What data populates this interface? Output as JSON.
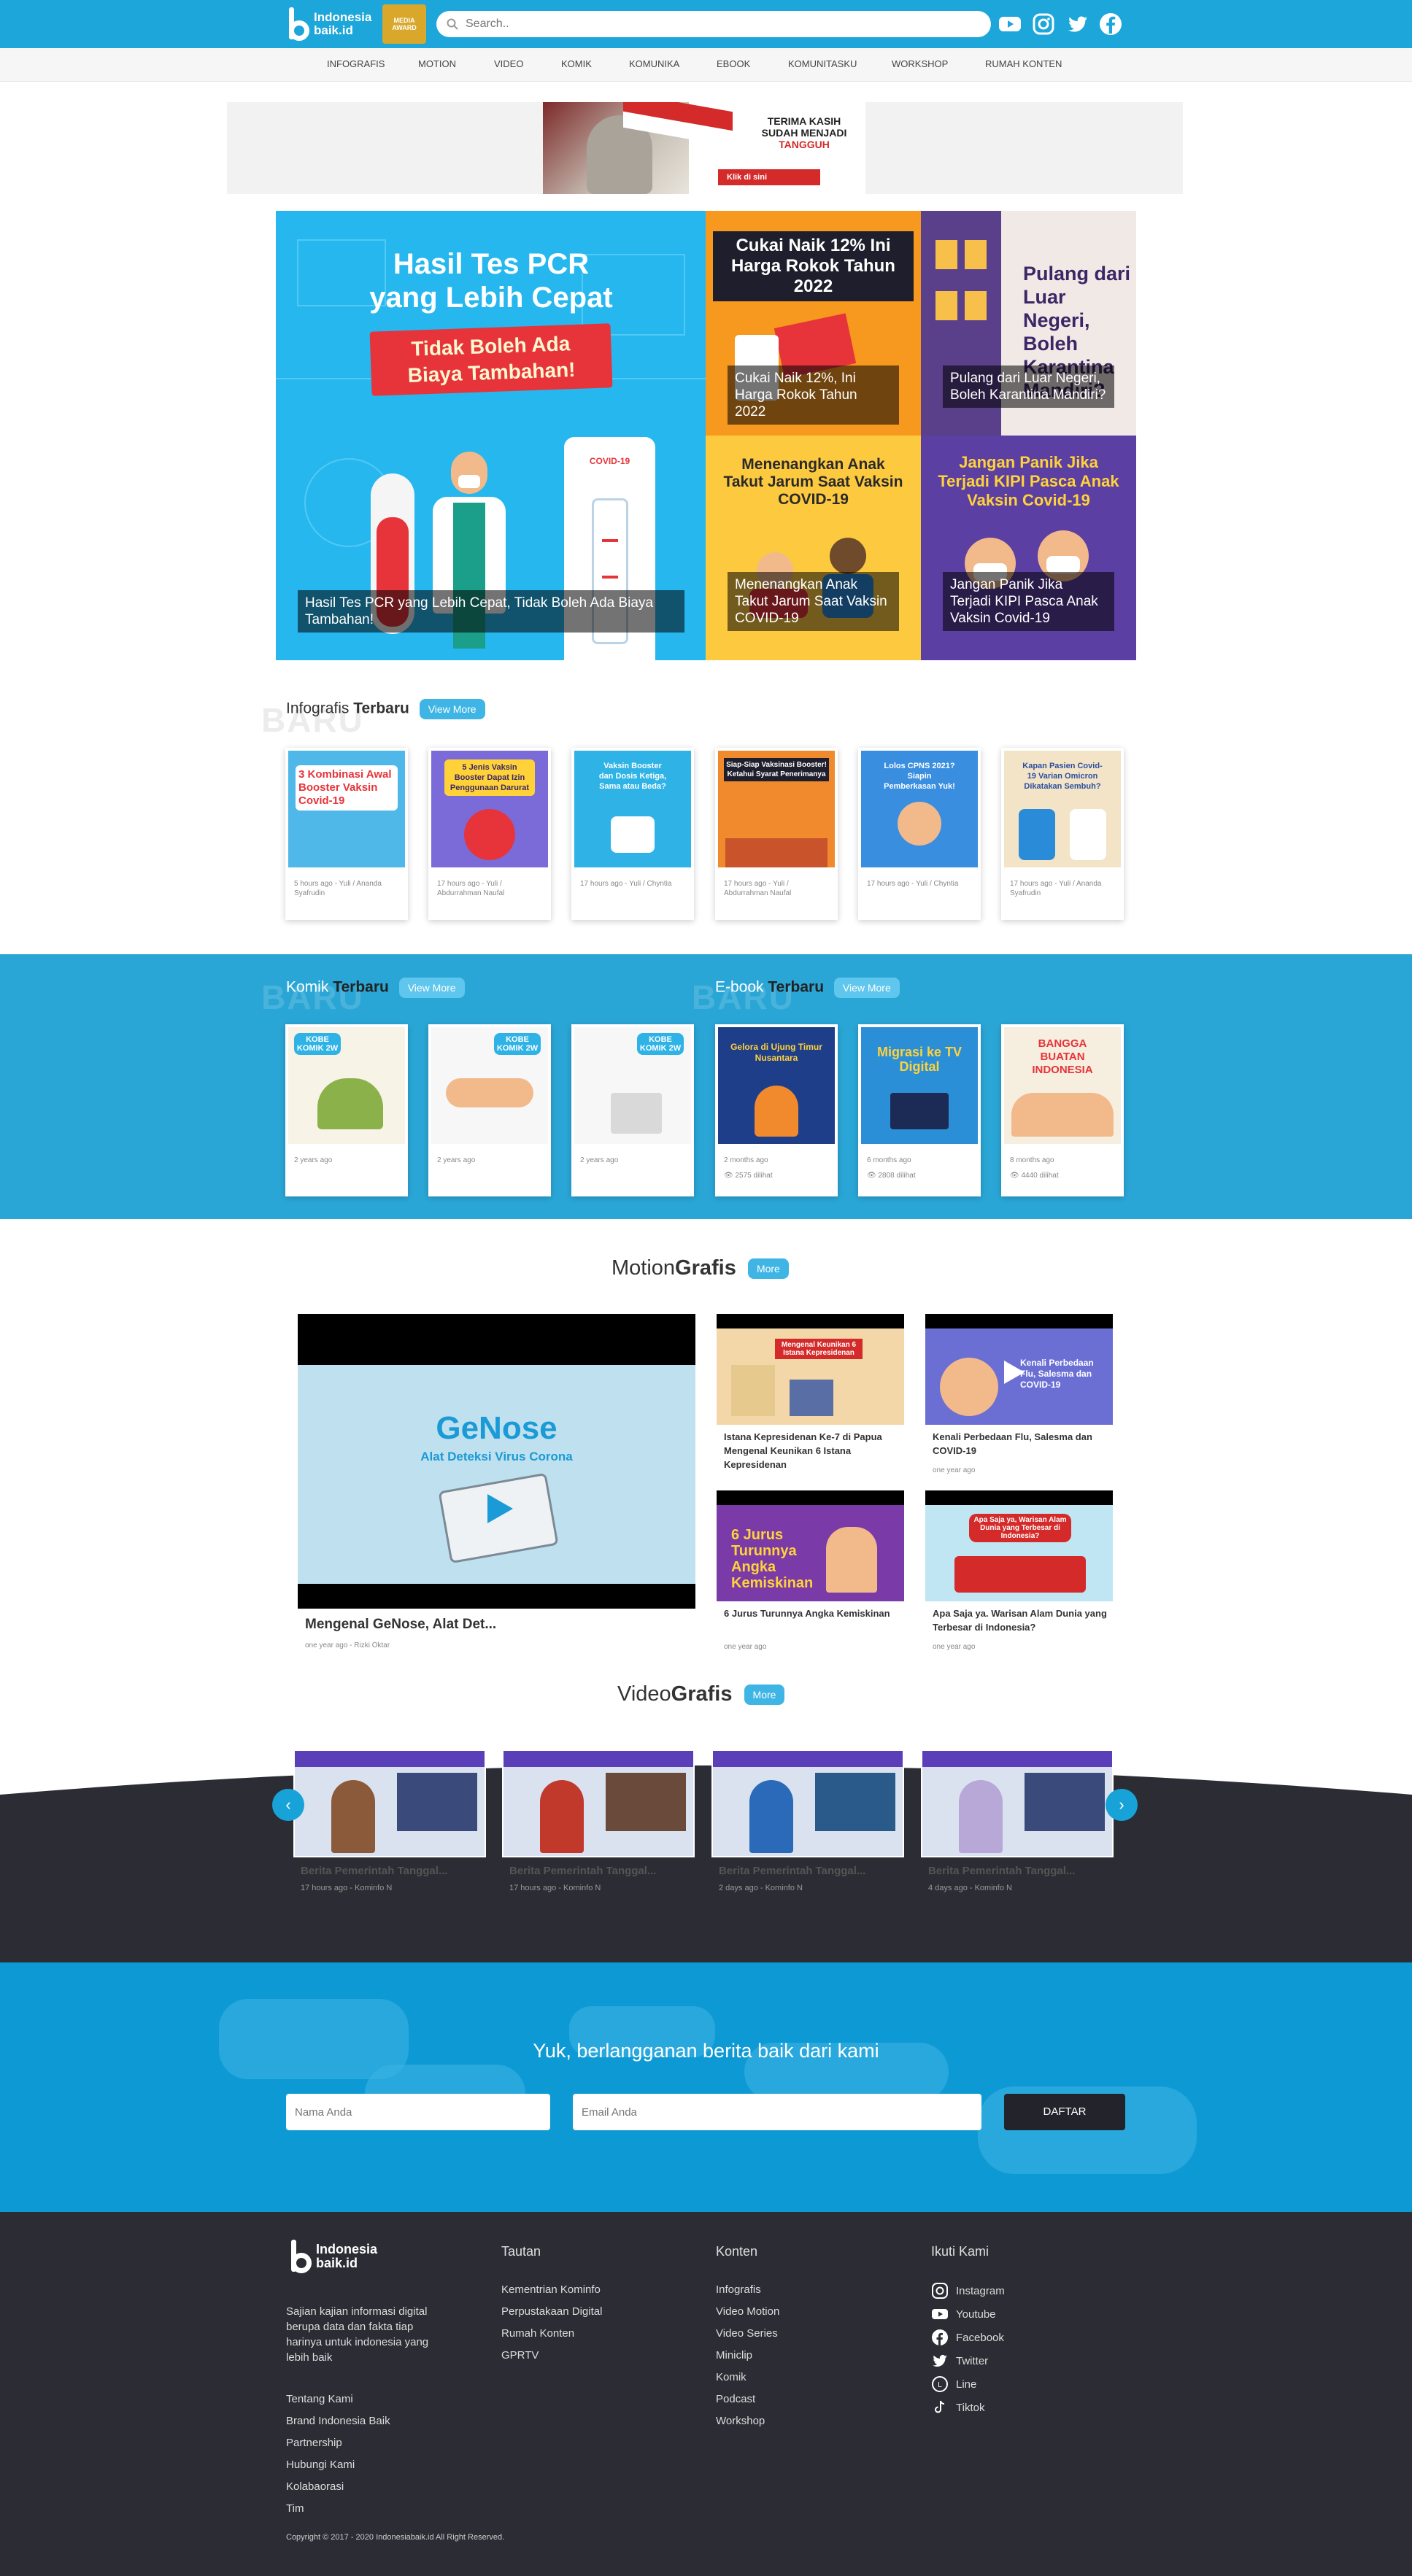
{
  "header": {
    "logo_line1": "Indonesia",
    "logo_line2": "baik.id",
    "emblem_text": "MEDIA AWARD",
    "search_placeholder": "Search..",
    "social_icons": [
      "youtube-icon",
      "instagram-icon",
      "twitter-icon",
      "facebook-icon"
    ]
  },
  "nav": {
    "items": [
      "INFOGRAFIS",
      "MOTION",
      "VIDEO",
      "KOMIK",
      "KOMUNIKA",
      "EBOOK",
      "KOMUNITASKU",
      "WORKSHOP",
      "RUMAH KONTEN"
    ]
  },
  "banner": {
    "line1": "TERIMA KASIH",
    "line2": "SUDAH MENJADI",
    "line3": "TANGGUH",
    "cta": "Klik di sini"
  },
  "hero": {
    "main": {
      "art_title1": "Hasil Tes PCR",
      "art_title2": "yang Lebih Cepat",
      "art_sub1": "Tidak Boleh Ada",
      "art_sub2": "Biaya Tambahan!",
      "caption": "Hasil Tes PCR yang Lebih Cepat, Tidak Boleh Ada Biaya Tambahan!",
      "tube_label": "COVID-19"
    },
    "tiles": [
      {
        "art": "Cukai Naik 12% Ini Harga Rokok Tahun 2022",
        "caption": "Cukai Naik 12%, Ini Harga Rokok Tahun 2022"
      },
      {
        "art": "Pulang dari Luar Negeri, Boleh Karantina Mandiri?",
        "caption": "Pulang dari Luar Negeri, Boleh Karantina Mandiri?"
      },
      {
        "art": "Menenangkan Anak Takut Jarum Saat Vaksin COVID-19",
        "caption": "Menenangkan Anak Takut Jarum Saat Vaksin COVID-19"
      },
      {
        "art": "Jangan Panik Jika Terjadi KIPI Pasca Anak Vaksin Covid-19",
        "caption": "Jangan Panik Jika Terjadi KIPI Pasca Anak Vaksin Covid-19"
      }
    ]
  },
  "infografis": {
    "label_light": "Infografis",
    "label_bold": "Terbaru",
    "ghost": "BARU",
    "view_more": "View More",
    "cards": [
      {
        "art": "3 Kombinasi Awal Booster Vaksin Covid-19",
        "meta": "5 hours ago - Yuli / Ananda Syafrudin",
        "color": "#4fb8e8"
      },
      {
        "art": "5 Jenis Vaksin Booster Dapat Izin Penggunaan Darurat",
        "meta": "17 hours ago - Yuli / Abdurrahman Naufal",
        "color": "#7b6bd9"
      },
      {
        "art": "Vaksin Booster dan Dosis Ketiga, Sama atau Beda?",
        "meta": "17 hours ago - Yuli / Chyntia",
        "color": "#2fb3e6"
      },
      {
        "art": "Siap-Siap Vaksinasi Booster! Ketahui Syarat Penerimanya",
        "meta": "17 hours ago - Yuli / Abdurrahman Naufal",
        "color": "#f08a2c"
      },
      {
        "art": "Lolos CPNS 2021? Siapin Pemberkasan Yuk!",
        "meta": "17 hours ago - Yuli / Chyntia",
        "color": "#3a8ee0"
      },
      {
        "art": "Kapan Pasien Covid-19 Varian Omicron Dikatakan Sembuh?",
        "meta": "17 hours ago - Yuli / Ananda Syafrudin",
        "color": "#f3e3c7"
      }
    ]
  },
  "komik": {
    "label_light": "Komik",
    "label_bold": "Terbaru",
    "ghost": "BARU",
    "view_more": "View More",
    "cards": [
      {
        "art": "KOBE KOMIK 2W",
        "meta": "2 years ago"
      },
      {
        "art": "KOBE KOMIK 2W",
        "meta": "2 years ago"
      },
      {
        "art": "KOBE KOMIK 2W",
        "meta": "2 years ago"
      }
    ]
  },
  "ebook": {
    "label_light": "E-book",
    "label_bold": "Terbaru",
    "ghost": "BARU",
    "view_more": "View More",
    "cards": [
      {
        "art": "Gelora di Ujung Timur Nusantara",
        "meta": "2 months ago",
        "views": "2575 dilihat",
        "color": "#1f3e8a"
      },
      {
        "art": "Migrasi ke TV Digital",
        "meta": "6 months ago",
        "views": "2808 dilihat",
        "color": "#2b8fd8"
      },
      {
        "art": "BANGGA BUATAN INDONESIA",
        "meta": "8 months ago",
        "views": "4440 dilihat",
        "color": "#f6efe0"
      }
    ]
  },
  "motion": {
    "label_light": "Motion",
    "label_bold": "Grafis",
    "more": "More",
    "feature": {
      "art_title": "GeNose",
      "art_sub": "Alat Deteksi Virus Corona",
      "title": "Mengenal GeNose, Alat Det...",
      "meta": "one year ago - Rizki Oktar"
    },
    "items": [
      {
        "art": "Mengenal Keunikan 6 Istana Kepresidenan",
        "title": "Istana Kepresidenan Ke-7 di Papua Mengenal Keunikan 6 Istana Kepresidenan",
        "meta": ""
      },
      {
        "art": "Kenali Perbedaan Flu, Salesma dan COVID-19",
        "title": "Kenali Perbedaan Flu, Salesma dan COVID-19",
        "meta": "one year ago"
      },
      {
        "art": "6 Jurus Turunnya Angka Kemiskinan",
        "title": "6 Jurus Turunnya Angka Kemiskinan",
        "meta": "one year ago"
      },
      {
        "art": "Apa Saja ya, Warisan Alam Dunia yang Terbesar di Indonesia?",
        "title": "Apa Saja ya. Warisan Alam Dunia yang Terbesar di Indonesia?",
        "meta": "one year ago"
      }
    ]
  },
  "video": {
    "label_light": "Video",
    "label_bold": "Grafis",
    "more": "More",
    "items": [
      {
        "title": "Berita Pemerintah Tanggal...",
        "meta": "17 hours ago - Kominfo N"
      },
      {
        "title": "Berita Pemerintah Tanggal...",
        "meta": "17 hours ago - Kominfo N"
      },
      {
        "title": "Berita Pemerintah Tanggal...",
        "meta": "2 days ago - Kominfo N"
      },
      {
        "title": "Berita Pemerintah Tanggal...",
        "meta": "4 days ago - Kominfo N"
      }
    ]
  },
  "subscribe": {
    "title": "Yuk, berlangganan berita baik dari kami",
    "name_placeholder": "Nama Anda",
    "email_placeholder": "Email Anda",
    "button": "DAFTAR"
  },
  "footer": {
    "about": "Sajian kajian informasi digital berupa data dan fakta tiap harinya untuk indonesia yang lebih baik",
    "about_links": [
      "Tentang Kami",
      "Brand Indonesia Baik",
      "Partnership",
      "Hubungi Kami",
      "Kolabaorasi",
      "Tim"
    ],
    "tautan_head": "Tautan",
    "tautan": [
      "Kementrian Kominfo",
      "Perpustakaan Digital",
      "Rumah Konten",
      "GPRTV"
    ],
    "konten_head": "Konten",
    "konten": [
      "Infografis",
      "Video Motion",
      "Video Series",
      "Miniclip",
      "Komik",
      "Podcast",
      "Workshop"
    ],
    "ikuti_head": "Ikuti Kami",
    "ikuti": [
      {
        "label": "Instagram",
        "icon": "instagram-icon"
      },
      {
        "label": "Youtube",
        "icon": "youtube-icon"
      },
      {
        "label": "Facebook",
        "icon": "facebook-icon"
      },
      {
        "label": "Twitter",
        "icon": "twitter-icon"
      },
      {
        "label": "Line",
        "icon": "line-icon"
      },
      {
        "label": "Tiktok",
        "icon": "tiktok-icon"
      }
    ],
    "copyright": "Copyright © 2017 - 2020 Indonesiabaik.id All Right Reserved."
  },
  "colors": {
    "brand": "#1ca6d9",
    "dark": "#2c2c34",
    "accent_red": "#d42a2a"
  }
}
